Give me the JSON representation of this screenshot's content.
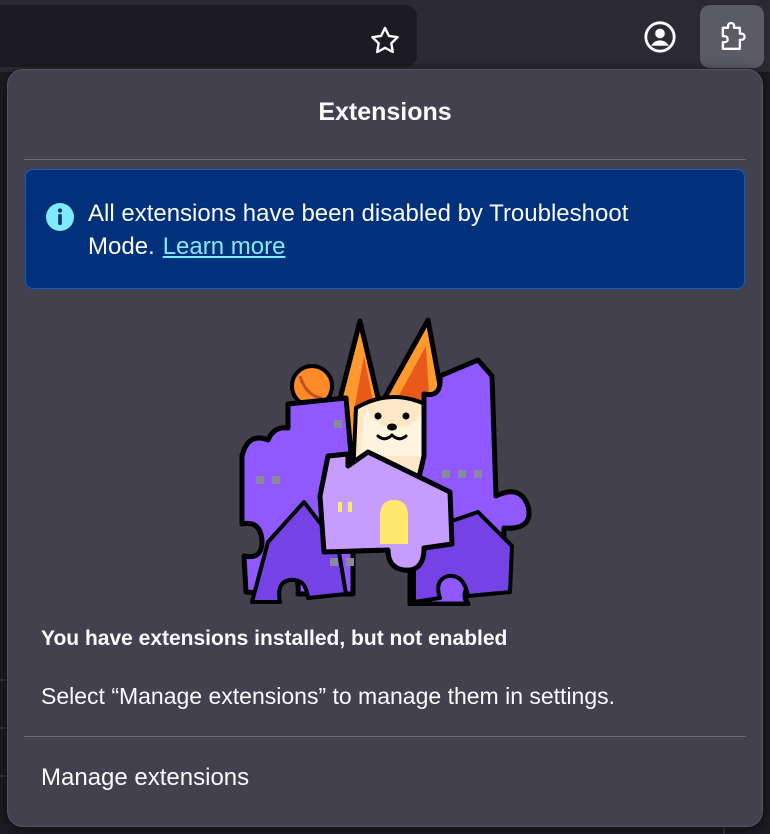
{
  "panel": {
    "title": "Extensions",
    "notice": {
      "message": "All extensions have been disabled by Troubleshoot Mode.",
      "link": "Learn more"
    },
    "empty_state": {
      "heading": "You have extensions installed, but not enabled",
      "description": "Select “Manage extensions” to manage them in settings."
    },
    "manage_label": "Manage extensions"
  },
  "toolbar": {
    "icons": [
      "star-icon",
      "account-icon",
      "extensions-puzzle-icon"
    ]
  },
  "colors": {
    "panel_bg": "#42414d",
    "notice_bg": "#00317a",
    "link": "#80ebff",
    "accent_purple": "#9059ff",
    "fox_orange": "#ff7139"
  }
}
